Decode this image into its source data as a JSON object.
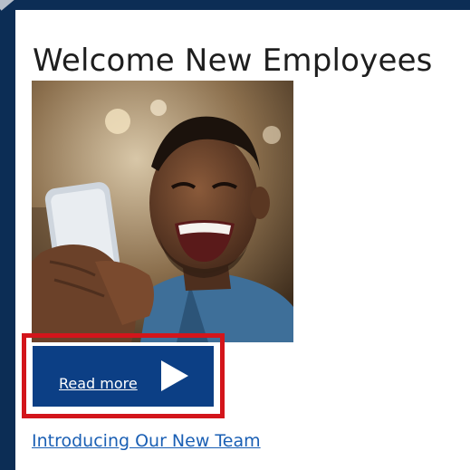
{
  "card": {
    "title": "Welcome New Employees"
  },
  "hero_image": {
    "description_icon": "smiling-man-with-phone-photo"
  },
  "read_more_button": {
    "label": "Read more",
    "icon": "play-icon",
    "color": "#0c3f85"
  },
  "team_link": {
    "label": "Introducing Our New Team",
    "color": "#1a5fb4"
  },
  "highlight": {
    "color": "#d3151b"
  }
}
